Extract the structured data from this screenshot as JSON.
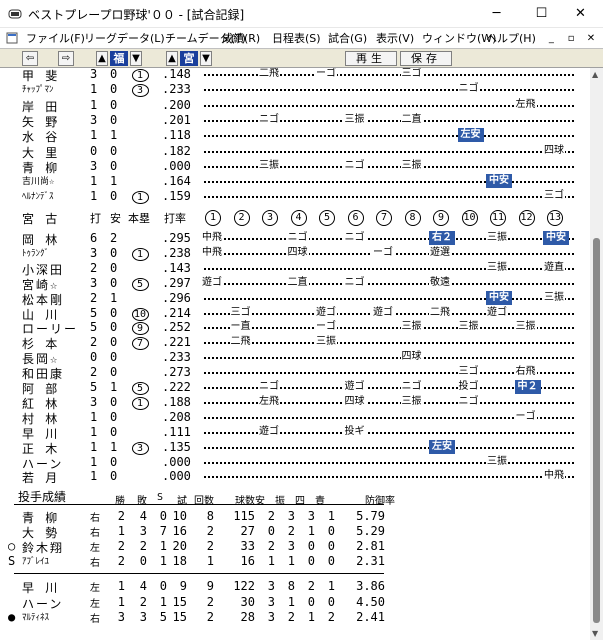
{
  "window": {
    "title": "ベストプレープロ野球'００ - [試合記録]",
    "controls": {
      "minimize": "─",
      "maximize": "☐",
      "close": "✕"
    }
  },
  "menu": {
    "items": [
      "ファイル(F)",
      "リーグデータ(L)",
      "チームデータ(T)",
      "成績(R)",
      "日程表(S)",
      "試合(G)",
      "表示(V)",
      "ウィンドウ(W)",
      "ヘルプ(H)"
    ],
    "mdi": [
      "_",
      "▫",
      "✕"
    ]
  },
  "toolbar": {
    "team1": "福",
    "team2": "宮",
    "replay": "再生",
    "save": "保存"
  },
  "away_batting": [
    {
      "name": "甲 斐",
      "ab": "3",
      "h": "0",
      "hr": "1",
      "avg": ".148",
      "results": [
        {
          "i": 3,
          "t": "二飛"
        },
        {
          "i": 5,
          "t": "ーゴ"
        },
        {
          "i": 8,
          "t": "三ゴ"
        }
      ]
    },
    {
      "name": "ﾁｬｯﾌﾟﾏﾝ",
      "small": true,
      "ab": "1",
      "h": "0",
      "hr": "3",
      "avg": ".233",
      "results": [
        {
          "i": 10,
          "t": "ニゴ"
        }
      ]
    },
    {
      "name": "岸 田",
      "ab": "1",
      "h": "0",
      "hr": "",
      "avg": ".200",
      "results": [
        {
          "i": 12,
          "t": "左飛"
        }
      ]
    },
    {
      "name": "矢 野",
      "ab": "3",
      "h": "0",
      "hr": "",
      "avg": ".201",
      "results": [
        {
          "i": 3,
          "t": "ニゴ"
        },
        {
          "i": 6,
          "t": "三振"
        },
        {
          "i": 8,
          "t": "二直"
        }
      ]
    },
    {
      "name": "水 谷",
      "ab": "1",
      "h": "1",
      "hr": "",
      "avg": ".118",
      "results": [
        {
          "i": 10,
          "t": "左安",
          "hit": true
        }
      ]
    },
    {
      "name": "大 里",
      "ab": "0",
      "h": "0",
      "hr": "",
      "avg": ".182",
      "results": [
        {
          "i": 13,
          "t": "四球"
        }
      ]
    },
    {
      "name": "青 柳",
      "ab": "3",
      "h": "0",
      "hr": "",
      "avg": ".000",
      "results": [
        {
          "i": 3,
          "t": "三振"
        },
        {
          "i": 6,
          "t": "ニゴ"
        },
        {
          "i": 8,
          "t": "三振"
        }
      ]
    },
    {
      "name": "吉川尚☆",
      "small": true,
      "ab": "1",
      "h": "1",
      "hr": "",
      "avg": ".164",
      "results": [
        {
          "i": 11,
          "t": "中安",
          "hit": true
        }
      ]
    },
    {
      "name": "ﾍﾙﾅﾝﾃﾞｽ",
      "small": true,
      "ab": "1",
      "h": "0",
      "hr": "1",
      "avg": ".159",
      "results": [
        {
          "i": 13,
          "t": "三ゴ"
        }
      ]
    }
  ],
  "home_team": {
    "name": "宮 古",
    "headers": {
      "ab": "打",
      "h": "安",
      "hr": "本塁",
      "avg": "打率"
    },
    "innings": [
      "1",
      "2",
      "3",
      "4",
      "5",
      "6",
      "7",
      "8",
      "9",
      "10",
      "11",
      "12",
      "13"
    ]
  },
  "home_batting": [
    {
      "name": "岡 林",
      "ab": "6",
      "h": "2",
      "hr": "",
      "avg": ".295",
      "results": [
        {
          "i": 1,
          "t": "中飛"
        },
        {
          "i": 4,
          "t": "ニゴ"
        },
        {
          "i": 6,
          "t": "ニゴ"
        },
        {
          "i": 9,
          "t": "右２",
          "hit": true
        },
        {
          "i": 11,
          "t": "三振"
        },
        {
          "i": 13,
          "t": "中安",
          "hit": true
        }
      ]
    },
    {
      "name": "ﾄｩﾗﾝｸﾞ",
      "small": true,
      "ab": "3",
      "h": "0",
      "hr": "1",
      "avg": ".238",
      "results": [
        {
          "i": 1,
          "t": "中飛"
        },
        {
          "i": 4,
          "t": "四球"
        },
        {
          "i": 7,
          "t": "ーゴ"
        },
        {
          "i": 9,
          "t": "遊選"
        }
      ]
    },
    {
      "name": "小深田",
      "ab": "2",
      "h": "0",
      "hr": "",
      "avg": ".143",
      "results": [
        {
          "i": 11,
          "t": "三振"
        },
        {
          "i": 13,
          "t": "遊直"
        }
      ]
    },
    {
      "name": "宮崎☆",
      "ab": "3",
      "h": "0",
      "hr": "5",
      "avg": ".297",
      "results": [
        {
          "i": 1,
          "t": "遊ゴ"
        },
        {
          "i": 4,
          "t": "二直"
        },
        {
          "i": 6,
          "t": "ニゴ"
        },
        {
          "i": 9,
          "t": "敬遠"
        }
      ]
    },
    {
      "name": "松本剛",
      "ab": "2",
      "h": "1",
      "hr": "",
      "avg": ".296",
      "results": [
        {
          "i": 11,
          "t": "中安",
          "hit": true
        },
        {
          "i": 13,
          "t": "三振"
        }
      ]
    },
    {
      "name": "山 川",
      "ab": "5",
      "h": "0",
      "hr": "10",
      "avg": ".214",
      "results": [
        {
          "i": 2,
          "t": "三ゴ"
        },
        {
          "i": 5,
          "t": "遊ゴ"
        },
        {
          "i": 7,
          "t": "遊ゴ"
        },
        {
          "i": 9,
          "t": "二飛"
        },
        {
          "i": 11,
          "t": "遊ゴ"
        }
      ]
    },
    {
      "name": "ローリー",
      "ab": "5",
      "h": "0",
      "hr": "9",
      "avg": ".252",
      "results": [
        {
          "i": 2,
          "t": "ー直"
        },
        {
          "i": 5,
          "t": "ーゴ"
        },
        {
          "i": 8,
          "t": "三振"
        },
        {
          "i": 10,
          "t": "三振"
        },
        {
          "i": 12,
          "t": "三振"
        }
      ]
    },
    {
      "name": "杉 本",
      "ab": "2",
      "h": "0",
      "hr": "7",
      "avg": ".221",
      "results": [
        {
          "i": 2,
          "t": "二飛"
        },
        {
          "i": 5,
          "t": "三振"
        }
      ]
    },
    {
      "name": "長岡☆",
      "ab": "0",
      "h": "0",
      "hr": "",
      "avg": ".233",
      "results": [
        {
          "i": 8,
          "t": "四球"
        }
      ]
    },
    {
      "name": "和田康",
      "ab": "2",
      "h": "0",
      "hr": "",
      "avg": ".273",
      "results": [
        {
          "i": 10,
          "t": "三ゴ"
        },
        {
          "i": 12,
          "t": "右飛"
        }
      ]
    },
    {
      "name": "阿 部",
      "ab": "5",
      "h": "1",
      "hr": "5",
      "avg": ".222",
      "results": [
        {
          "i": 3,
          "t": "ニゴ"
        },
        {
          "i": 6,
          "t": "遊ゴ"
        },
        {
          "i": 8,
          "t": "ニゴ"
        },
        {
          "i": 10,
          "t": "投ゴ"
        },
        {
          "i": 12,
          "t": "中２",
          "hit": true
        }
      ]
    },
    {
      "name": "紅 林",
      "ab": "3",
      "h": "0",
      "hr": "1",
      "avg": ".188",
      "results": [
        {
          "i": 3,
          "t": "左飛"
        },
        {
          "i": 6,
          "t": "四球"
        },
        {
          "i": 8,
          "t": "三振"
        },
        {
          "i": 10,
          "t": "ニゴ"
        }
      ]
    },
    {
      "name": "村 林",
      "ab": "1",
      "h": "0",
      "hr": "",
      "avg": ".208",
      "results": [
        {
          "i": 12,
          "t": "ーゴ"
        }
      ]
    },
    {
      "name": "早 川",
      "ab": "1",
      "h": "0",
      "hr": "",
      "avg": ".111",
      "results": [
        {
          "i": 3,
          "t": "遊ゴ"
        },
        {
          "i": 6,
          "t": "投ギ"
        }
      ]
    },
    {
      "name": "正 木",
      "ab": "1",
      "h": "1",
      "hr": "3",
      "avg": ".135",
      "results": [
        {
          "i": 9,
          "t": "左安",
          "hit": true
        }
      ]
    },
    {
      "name": "ハーン",
      "ab": "1",
      "h": "0",
      "hr": "",
      "avg": ".000",
      "results": [
        {
          "i": 11,
          "t": "三振"
        }
      ]
    },
    {
      "name": "若 月",
      "ab": "1",
      "h": "0",
      "hr": "",
      "avg": ".000",
      "results": [
        {
          "i": 13,
          "t": "中飛"
        }
      ]
    }
  ],
  "pitching": {
    "title": "投手成績",
    "headers": [
      "勝",
      "敗",
      "S",
      "試",
      "回数",
      "球数",
      "安",
      "振",
      "四",
      "責",
      "防御率"
    ],
    "away": [
      {
        "mark": "",
        "name": "青 柳",
        "hand": "右",
        "stats": [
          "2",
          "4",
          "0",
          "10",
          "8",
          "115",
          "2",
          "3",
          "3",
          "1",
          "5.79"
        ]
      },
      {
        "mark": "",
        "name": "大 勢",
        "hand": "右",
        "stats": [
          "1",
          "3",
          "7",
          "16",
          "2",
          "27",
          "0",
          "2",
          "1",
          "0",
          "5.29"
        ]
      },
      {
        "mark": "○",
        "name": "鈴木翔",
        "hand": "左",
        "stats": [
          "2",
          "2",
          "1",
          "20",
          "2",
          "33",
          "2",
          "3",
          "0",
          "0",
          "2.81"
        ]
      },
      {
        "mark": "S",
        "name": "ｱﾌﾞﾚｲﾕ",
        "small": true,
        "hand": "右",
        "stats": [
          "2",
          "0",
          "1",
          "18",
          "1",
          "16",
          "1",
          "1",
          "0",
          "0",
          "2.31"
        ]
      }
    ],
    "home": [
      {
        "mark": "",
        "name": "早 川",
        "hand": "左",
        "stats": [
          "1",
          "4",
          "0",
          "9",
          "9",
          "122",
          "3",
          "8",
          "2",
          "1",
          "3.86"
        ]
      },
      {
        "mark": "",
        "name": "ハーン",
        "hand": "左",
        "stats": [
          "1",
          "2",
          "1",
          "15",
          "2",
          "30",
          "3",
          "1",
          "0",
          "0",
          "4.50"
        ]
      },
      {
        "mark": "●",
        "name": "ﾏﾙﾃｨﾈｽ",
        "small": true,
        "hand": "右",
        "stats": [
          "3",
          "3",
          "5",
          "15",
          "2",
          "28",
          "3",
          "2",
          "1",
          "2",
          "2.41"
        ]
      }
    ]
  }
}
